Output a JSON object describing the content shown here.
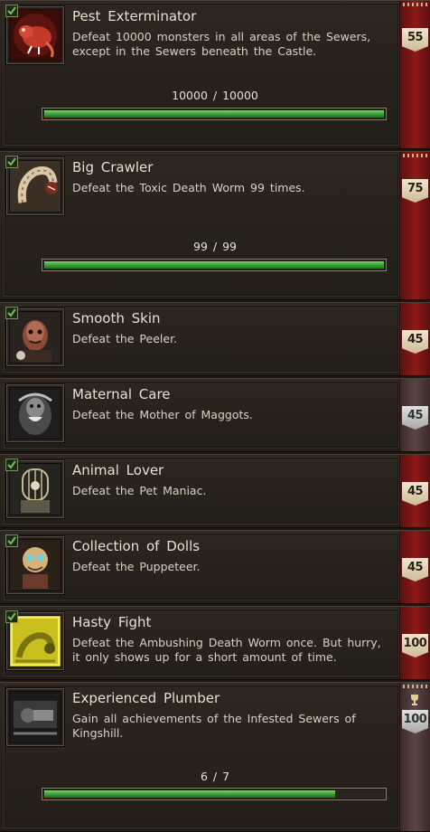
{
  "achievements": [
    {
      "title": "Pest Exterminator",
      "description": "Defeat 10000 monsters in all areas of the Sewers, except in the Sewers beneath the Castle.",
      "icon": "rat-icon",
      "completed": true,
      "points": "55",
      "progress_text": "10000  /  10000",
      "progress_fraction": 1.0
    },
    {
      "title": "Big Crawler",
      "description": "Defeat the Toxic Death Worm 99 times.",
      "icon": "worm-icon",
      "completed": true,
      "points": "75",
      "progress_text": "99  /  99",
      "progress_fraction": 1.0
    },
    {
      "title": "Smooth Skin",
      "description": "Defeat the Peeler.",
      "icon": "peeler-icon",
      "completed": true,
      "points": "45"
    },
    {
      "title": "Maternal Care",
      "description": "Defeat the Mother of Maggots.",
      "icon": "mother-maggots-icon",
      "completed": false,
      "points": "45"
    },
    {
      "title": "Animal Lover",
      "description": "Defeat the Pet Maniac.",
      "icon": "pet-maniac-icon",
      "completed": true,
      "points": "45"
    },
    {
      "title": "Collection of Dolls",
      "description": "Defeat the Puppeteer.",
      "icon": "puppeteer-icon",
      "completed": true,
      "points": "45"
    },
    {
      "title": "Hasty Fight",
      "description": "Defeat the Ambushing Death Worm once. But hurry, it only shows up for a short amount of time.",
      "icon": "ambush-worm-icon",
      "completed": true,
      "points": "100"
    },
    {
      "title": "Experienced Plumber",
      "description": "Gain all achievements of the Infested Sewers of Kingshill.",
      "icon": "plumber-icon",
      "completed": false,
      "points": "100",
      "progress_text": "6  /  7",
      "progress_fraction": 0.857
    }
  ],
  "colors": {
    "ribbon_red": "#8e1a17",
    "progress_green": "#3fa83a",
    "check_green": "#7cbf5a",
    "badge_gold": "#e6d8bb"
  }
}
